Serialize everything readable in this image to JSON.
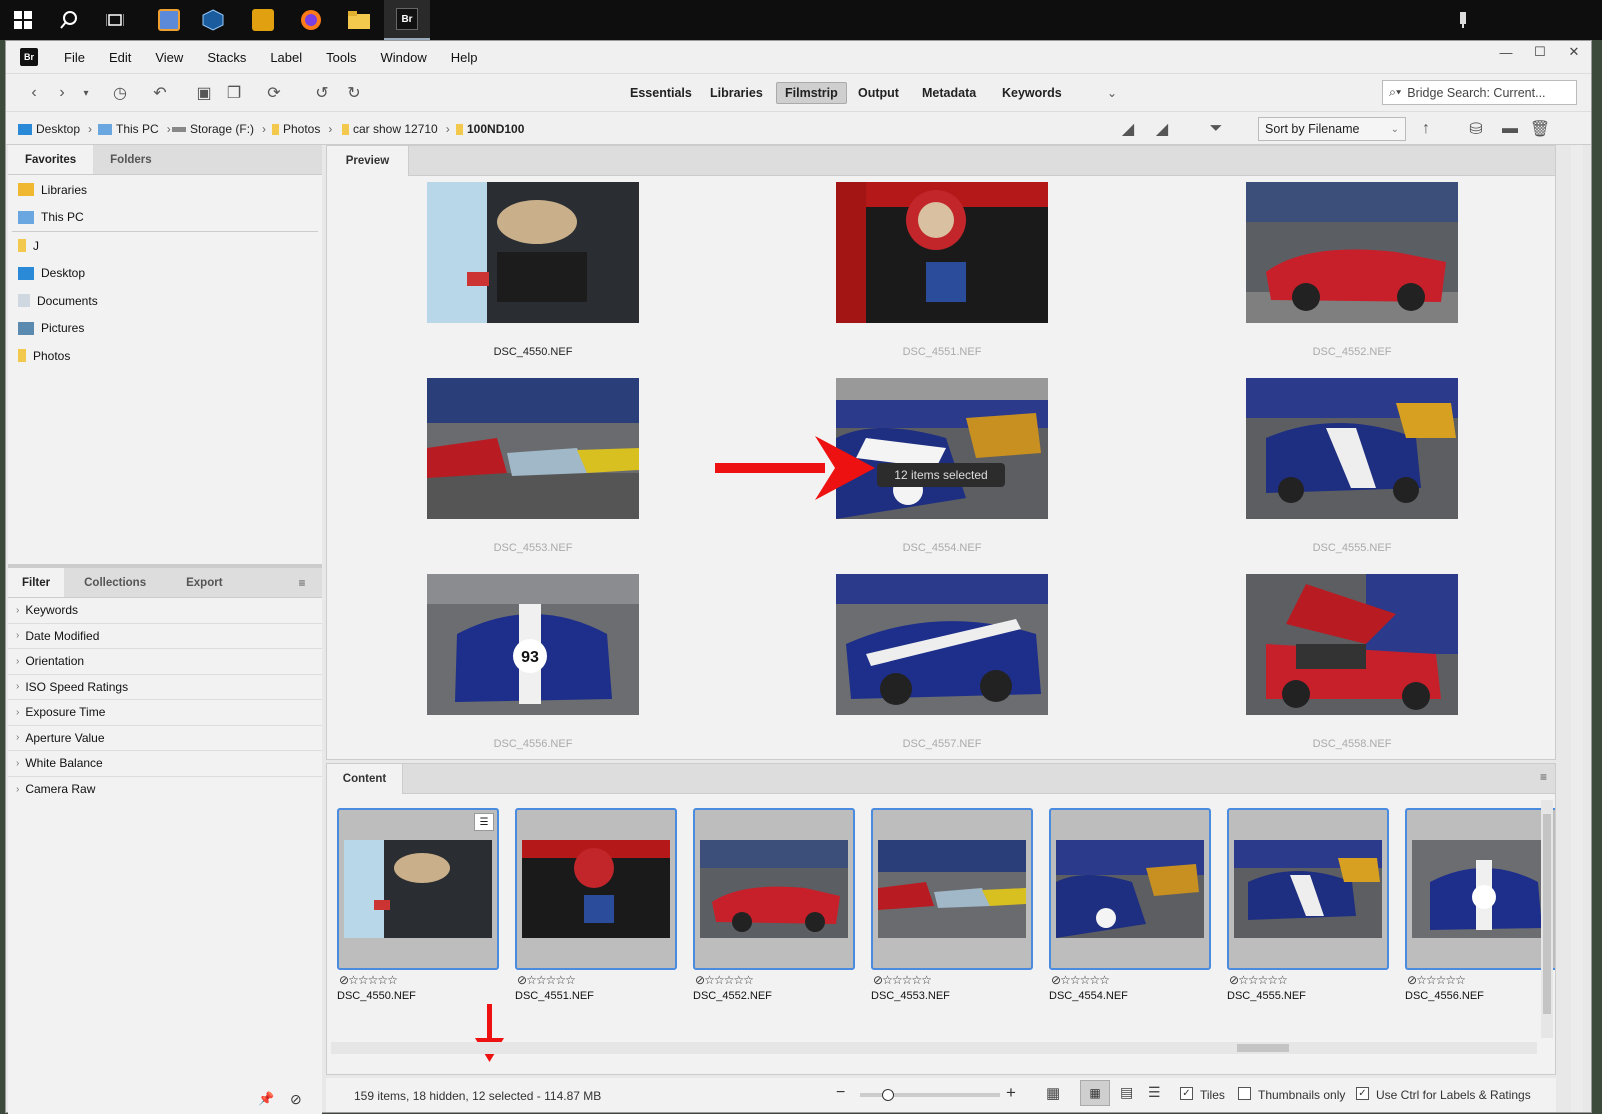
{
  "menus": [
    "File",
    "Edit",
    "View",
    "Stacks",
    "Label",
    "Tools",
    "Window",
    "Help"
  ],
  "app_icon": "Br",
  "workspaces": [
    "Essentials",
    "Libraries",
    "Filmstrip",
    "Output",
    "Metadata",
    "Keywords"
  ],
  "active_workspace": "Filmstrip",
  "search": {
    "placeholder": "Bridge Search: Current..."
  },
  "breadcrumb": [
    "Desktop",
    "This PC",
    "Storage (F:)",
    "Photos",
    "car show 12710",
    "100ND100"
  ],
  "sort_label": "Sort by Filename",
  "left_tabs": [
    "Favorites",
    "Folders"
  ],
  "favorites": [
    "Libraries",
    "This PC",
    "J",
    "Desktop",
    "Documents",
    "Pictures",
    "Photos"
  ],
  "filter_tabs": [
    "Filter",
    "Collections",
    "Export"
  ],
  "filters": [
    "Keywords",
    "Date Modified",
    "Orientation",
    "ISO Speed Ratings",
    "Exposure Time",
    "Aperture Value",
    "White Balance",
    "Camera Raw"
  ],
  "preview_tab": "Preview",
  "preview_items": [
    "DSC_4550.NEF",
    "DSC_4551.NEF",
    "DSC_4552.NEF",
    "DSC_4553.NEF",
    "DSC_4554.NEF",
    "DSC_4555.NEF",
    "DSC_4556.NEF",
    "DSC_4557.NEF",
    "DSC_4558.NEF"
  ],
  "tooltip": "12 items selected",
  "content_tab": "Content",
  "content_items": [
    "DSC_4550.NEF",
    "DSC_4551.NEF",
    "DSC_4552.NEF",
    "DSC_4553.NEF",
    "DSC_4554.NEF",
    "DSC_4555.NEF",
    "DSC_4556.NEF"
  ],
  "rating_stars": "☆☆☆☆☆",
  "status_text": "159 items, 18 hidden, 12 selected - 114.87 MB",
  "options": {
    "tiles": "Tiles",
    "thumbs_only": "Thumbnails only",
    "ctrl_labels": "Use Ctrl for Labels & Ratings"
  },
  "badge_number": "93",
  "accent": "#4a8be0",
  "annotation_color": "#ee1111"
}
